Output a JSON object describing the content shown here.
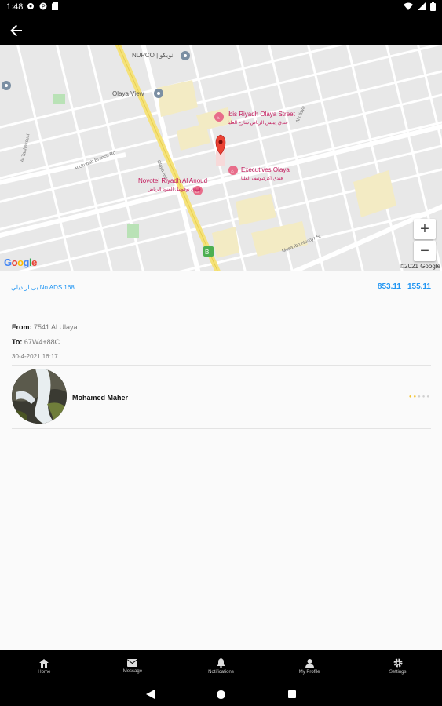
{
  "status_bar": {
    "time": "1:48"
  },
  "map": {
    "poi_nupco": "NUPCO | نوبكو",
    "poi_olaya_view": "Olaya View",
    "poi_ibis_en": "ibis Riyadh Olaya Street",
    "poi_ibis_ar": "فندق إيبيس الرياض شارع العليا",
    "poi_novotel_en": "Novotel Riyadh Al Anoud",
    "poi_novotel_ar": "فندق نوفوتيل العنود الرياض",
    "poi_executives_en": "Executives Olaya",
    "poi_executives_ar": "فندق اكزكيوتيف العليا",
    "road_olaya": "Olaya Rd",
    "road_al_takhassusi": "Al Takhassusi",
    "road_musa": "Musa Ibn Nusayr St",
    "road_al_olaya": "Al Olaya",
    "road_al_urubah": "Al Urubah Branch Rd",
    "copyright": "©2021 Google",
    "google_logo": "Google",
    "zoom_in": "+",
    "zoom_out": "−"
  },
  "price_row": {
    "plate": "بى ار ديلي No ADS 168",
    "price_1": "853.11",
    "price_2": "155.11"
  },
  "trip": {
    "from_label": "From:",
    "from_value": "7541 Al Ulaya",
    "to_label": "To:",
    "to_value": "67W4+88C",
    "date": "30-4-2021 16:17"
  },
  "driver": {
    "name": "Mohamed Maher",
    "rating": 2,
    "rating_max": 5
  },
  "bottom_nav": [
    {
      "label": "Home",
      "icon": "home-icon"
    },
    {
      "label": "Message",
      "icon": "message-icon"
    },
    {
      "label": "Notifications",
      "icon": "bell-icon"
    },
    {
      "label": "My Profile",
      "icon": "person-icon"
    },
    {
      "label": "Settings",
      "icon": "gear-icon"
    }
  ],
  "colors": {
    "accent": "#2196f3",
    "marker": "#ea4335",
    "star_filled": "#f4c430",
    "star_empty": "#d0d0d0"
  }
}
